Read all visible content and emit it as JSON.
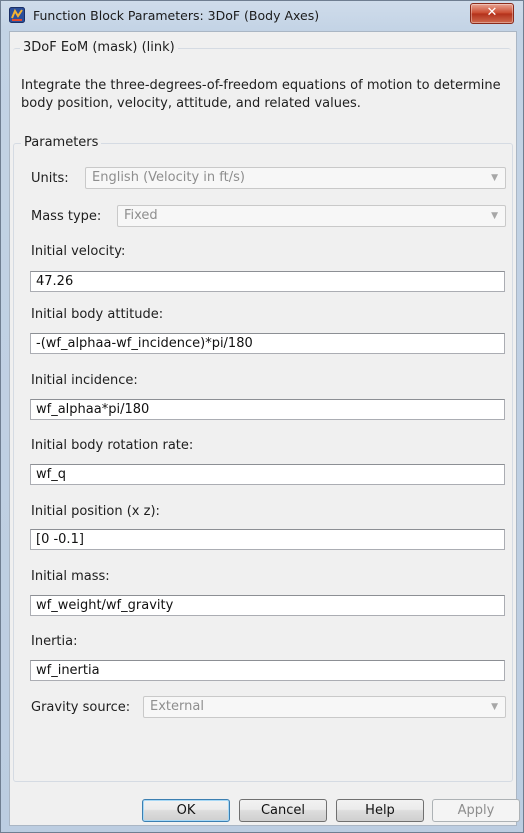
{
  "window": {
    "title": "Function Block Parameters: 3DoF (Body Axes)",
    "close_symbol": "✕"
  },
  "mask": {
    "group_title": "3DoF EoM (mask) (link)",
    "description": "Integrate the three-degrees-of-freedom equations of motion to determine body position, velocity, attitude, and related values."
  },
  "parameters": {
    "group_title": "Parameters",
    "units": {
      "label": "Units:",
      "value": "English (Velocity in ft/s)"
    },
    "mass_type": {
      "label": "Mass type:",
      "value": "Fixed"
    },
    "initial_velocity": {
      "label": "Initial velocity:",
      "value": "47.26"
    },
    "initial_body_attitude": {
      "label": "Initial body attitude:",
      "value": "-(wf_alphaa-wf_incidence)*pi/180"
    },
    "initial_incidence": {
      "label": "Initial incidence:",
      "value": "wf_alphaa*pi/180"
    },
    "initial_body_rotation_rate": {
      "label": "Initial body rotation rate:",
      "value": "wf_q"
    },
    "initial_position": {
      "label": "Initial position (x z):",
      "value": "[0 -0.1]"
    },
    "initial_mass": {
      "label": "Initial mass:",
      "value": "wf_weight/wf_gravity"
    },
    "inertia": {
      "label": "Inertia:",
      "value": "wf_inertia"
    },
    "gravity_source": {
      "label": "Gravity source:",
      "value": "External"
    }
  },
  "buttons": {
    "ok": "OK",
    "cancel": "Cancel",
    "help": "Help",
    "apply": "Apply"
  },
  "colors": {
    "frame": "#c3d3e5",
    "close_button": "#c9472b",
    "client_bg": "#f0f0f0"
  }
}
